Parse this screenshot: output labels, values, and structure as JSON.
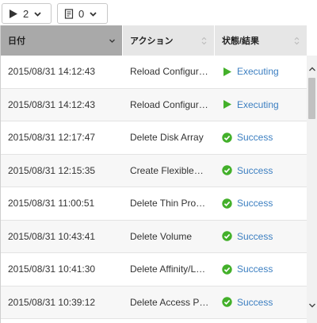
{
  "filters": {
    "executing": {
      "icon": "play-icon",
      "count": "2"
    },
    "tasks": {
      "icon": "task-list-icon",
      "count": "0"
    }
  },
  "columns": [
    {
      "label": "日付",
      "sorted": true
    },
    {
      "label": "アクション",
      "sorted": false
    },
    {
      "label": "状態/結果",
      "sorted": false
    }
  ],
  "rows": [
    {
      "date": "2015/08/31 14:12:43",
      "action": "Reload Configur…",
      "status": "Executing",
      "status_icon": "play-icon"
    },
    {
      "date": "2015/08/31 14:12:43",
      "action": "Reload Configur…",
      "status": "Executing",
      "status_icon": "play-icon"
    },
    {
      "date": "2015/08/31 12:17:47",
      "action": "Delete Disk Array",
      "status": "Success",
      "status_icon": "check-circle-icon"
    },
    {
      "date": "2015/08/31 12:15:35",
      "action": "Create Flexible…",
      "status": "Success",
      "status_icon": "check-circle-icon"
    },
    {
      "date": "2015/08/31 11:00:51",
      "action": "Delete Thin Pro…",
      "status": "Success",
      "status_icon": "check-circle-icon"
    },
    {
      "date": "2015/08/31 10:43:41",
      "action": "Delete Volume",
      "status": "Success",
      "status_icon": "check-circle-icon"
    },
    {
      "date": "2015/08/31 10:41:30",
      "action": "Delete Affinity/L…",
      "status": "Success",
      "status_icon": "check-circle-icon"
    },
    {
      "date": "2015/08/31 10:39:12",
      "action": "Delete Access P…",
      "status": "Success",
      "status_icon": "check-circle-icon"
    }
  ],
  "colors": {
    "executing_icon": "#43b02a",
    "success_icon": "#43b02a",
    "status_text": "#3c7fc1",
    "sorted_header": "#a9a9a9"
  }
}
